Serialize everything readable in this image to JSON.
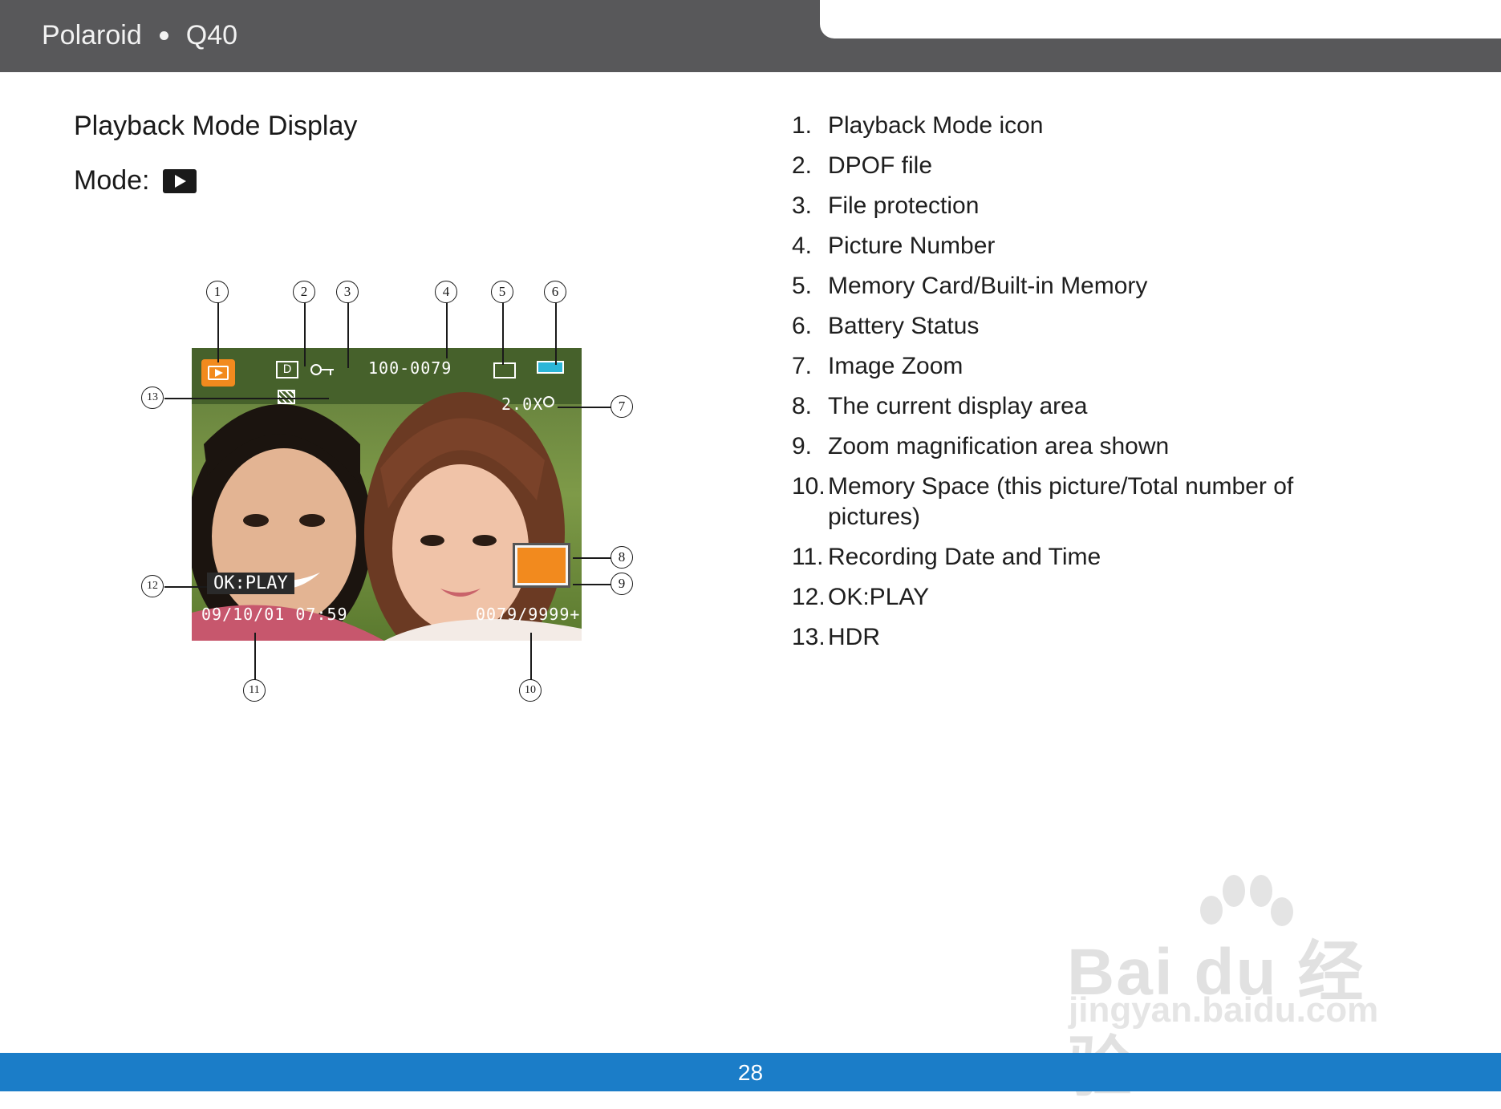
{
  "header": {
    "brand": "Polaroid",
    "model": "Q40"
  },
  "page": {
    "title": "Playback Mode Display",
    "mode_label": "Mode:"
  },
  "diagram": {
    "callouts": [
      "1",
      "2",
      "3",
      "4",
      "5",
      "6",
      "7",
      "8",
      "9",
      "10",
      "11",
      "12",
      "13"
    ],
    "overlay": {
      "picture_number": "100-0079",
      "zoom": "2.0X",
      "ok_play": "OK:PLAY",
      "datetime": "09/10/01 07:59",
      "memory_space": "0079/9999+"
    },
    "colors": {
      "accent_orange": "#f28a1e",
      "battery_cyan": "#2bb6d8"
    }
  },
  "legend": [
    {
      "num": "1.",
      "text": "Playback Mode icon"
    },
    {
      "num": "2.",
      "text": "DPOF file"
    },
    {
      "num": "3.",
      "text": "File protection"
    },
    {
      "num": "4.",
      "text": "Picture Number"
    },
    {
      "num": "5.",
      "text": "Memory Card/Built-in Memory"
    },
    {
      "num": "6.",
      "text": "Battery Status"
    },
    {
      "num": "7.",
      "text": "Image Zoom"
    },
    {
      "num": "8.",
      "text": "The current display area"
    },
    {
      "num": "9.",
      "text": "Zoom magnification area shown"
    },
    {
      "num": "10.",
      "text": "Memory Space (this picture/Total number of pictures)"
    },
    {
      "num": "11.",
      "text": "Recording Date and Time"
    },
    {
      "num": "12.",
      "text": "OK:PLAY"
    },
    {
      "num": "13.",
      "text": "HDR"
    }
  ],
  "footer": {
    "page_number": "28"
  },
  "watermark": {
    "logo": "Bai du 经验",
    "url": "jingyan.baidu.com"
  }
}
